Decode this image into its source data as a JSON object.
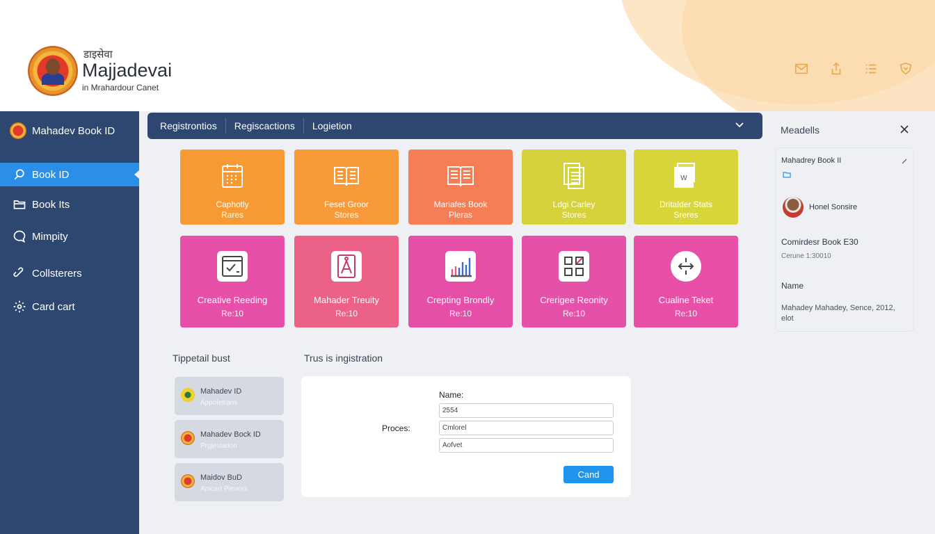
{
  "header": {
    "logo_script": "डाइसेवा",
    "logo_name": "Majjadevai",
    "logo_sub": "in Mrahardour Canet",
    "icons": [
      "mail-icon",
      "share-icon",
      "list-icon",
      "shield-icon"
    ]
  },
  "sidebar": {
    "brand": "Mahadev Book ID",
    "items": [
      {
        "label": "Book ID",
        "icon": "search-icon",
        "active": true
      },
      {
        "label": "Book Its",
        "icon": "folder-icon",
        "active": false
      },
      {
        "label": "Mimpity",
        "icon": "chat-icon",
        "active": false
      },
      {
        "label": "Collsterers",
        "icon": "link-icon",
        "active": false
      },
      {
        "label": "Card cart",
        "icon": "gear-icon",
        "active": false
      }
    ]
  },
  "tabs": [
    "Registrontios",
    "Regiscactions",
    "Logietion"
  ],
  "cards_row1": [
    {
      "title": "Caphotly",
      "sub": "Rares",
      "color": "#f79a34",
      "icon": "calendar-icon"
    },
    {
      "title": "Feset Groor",
      "sub": "Stores",
      "color": "#f89a3a",
      "icon": "book-icon"
    },
    {
      "title": "Mariafes Book",
      "sub": "Pleras",
      "color": "#f57e55",
      "icon": "open-book-icon"
    },
    {
      "title": "Ldgi Carley",
      "sub": "Stores",
      "color": "#d6d23c",
      "icon": "document-icon"
    },
    {
      "title": "Dritalder Stats",
      "sub": "Sreres",
      "color": "#d9d63c",
      "icon": "word-document-icon"
    }
  ],
  "cards_row2": [
    {
      "title": "Creative Reeding",
      "sub": "Re:10",
      "color": "#e650a8",
      "icon": "checklist-icon"
    },
    {
      "title": "Mahader Treuity",
      "sub": "Re:10",
      "color": "#ec6286",
      "icon": "letter-a-icon"
    },
    {
      "title": "Crepting Brondly",
      "sub": "Re:10",
      "color": "#e54fa8",
      "icon": "bar-chart-icon"
    },
    {
      "title": "Crerigee Reonity",
      "sub": "Re:10",
      "color": "#e551a8",
      "icon": "grid-icon"
    },
    {
      "title": "Cualine Teket",
      "sub": "Re:10",
      "color": "#e84fa6",
      "icon": "arrows-icon"
    }
  ],
  "bottom_left": {
    "title": "Tippetail bust",
    "items": [
      {
        "name": "Mahadev ID",
        "sub": "Appoletrans"
      },
      {
        "name": "Mahadev Bock ID",
        "sub": "Prgjestation"
      },
      {
        "name": "Maidov BuD",
        "sub": "Apicart Pleuors"
      }
    ]
  },
  "form": {
    "title": "Trus is ingistration",
    "name_label": "Name:",
    "process_label": "Proces:",
    "inputs": [
      "2554",
      "Cmlorel",
      "Aofvet"
    ],
    "button": "Cand"
  },
  "right_panel": {
    "title": "Meadells",
    "book_title": "Mahadrey Book II",
    "user_name": "Honel Sonsire",
    "section1_title": "Comirdesr Book E30",
    "section1_sub": "Cerune 1:30010",
    "section2_title": "Name",
    "section2_text": "Mahadey Mahadey, Sence, 2012, elot"
  },
  "colors": {
    "sidebar": "#2e4770",
    "active": "#2b8fe8",
    "button": "#1f94ef",
    "header_icon": "#e8a84a"
  }
}
